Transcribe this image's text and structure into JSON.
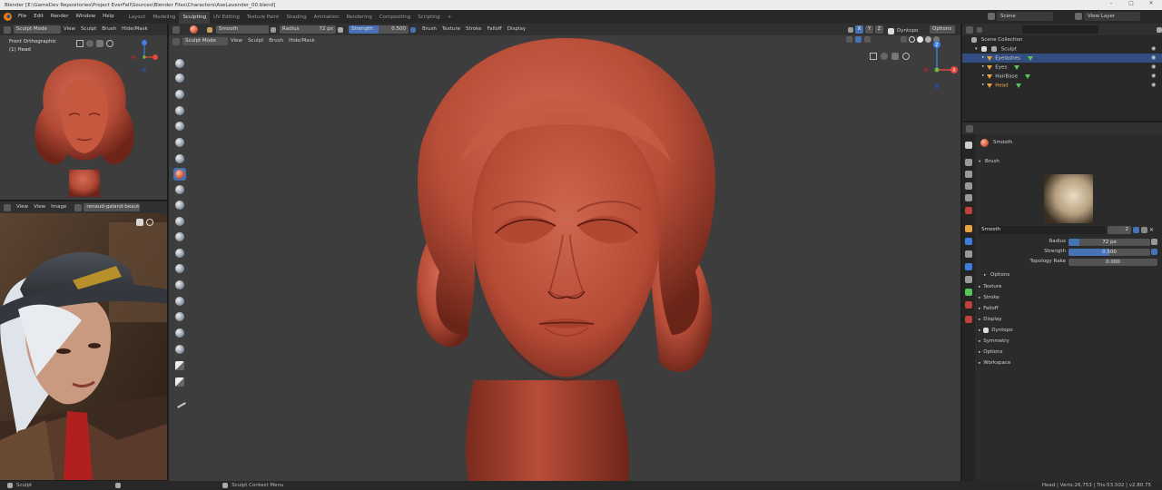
{
  "window": {
    "title": "Blender [E:\\GameDev Repositories\\Project EverFall\\Sources\\Blender Files\\Characters\\AxeLavender_00.blend]",
    "minimize_glyph": "–",
    "maximize_glyph": "□",
    "close_glyph": "✕"
  },
  "menu": {
    "items": [
      "File",
      "Edit",
      "Render",
      "Window",
      "Help"
    ]
  },
  "workspaces": {
    "tabs": [
      "Layout",
      "Modeling",
      "Sculpting",
      "UV Editing",
      "Texture Paint",
      "Shading",
      "Animation",
      "Rendering",
      "Compositing",
      "Scripting"
    ],
    "active": "Sculpting",
    "add": "+"
  },
  "scene": {
    "label": "Scene",
    "view_layer": "View Layer"
  },
  "left_viewport": {
    "mode": "Sculpt Mode",
    "menus": [
      "View",
      "Sculpt",
      "Brush",
      "Hide/Mask"
    ],
    "view_name": "Front Orthographic",
    "object": "(1) Head"
  },
  "image_editor": {
    "menus": [
      "View",
      "View",
      "Image"
    ],
    "image_name": "renaud-galand-beaut..."
  },
  "tool_header": {
    "brush_name": "Smooth",
    "radius_label": "Radius",
    "radius_value": "72 px",
    "strength_label": "Strength",
    "strength_value": "0.500",
    "menus": [
      "Brush",
      "Texture",
      "Stroke",
      "Falloff",
      "Display"
    ]
  },
  "main_viewport": {
    "mode": "Sculpt Mode",
    "menus": [
      "View",
      "Sculpt",
      "Brush",
      "Hide/Mask"
    ],
    "axes": [
      "X",
      "Y",
      "Z"
    ],
    "dyntopo": "Dyntopo",
    "options": "Options"
  },
  "gizmo_labels": {
    "x": "X",
    "y": "Y",
    "z": "Z"
  },
  "outliner": {
    "search_placeholder": "",
    "root": "Scene Collection",
    "collection": "Sculpt",
    "items": [
      {
        "name": "Eyelashes",
        "selected": true
      },
      {
        "name": "Eyes",
        "selected": false
      },
      {
        "name": "HairBase",
        "selected": false
      },
      {
        "name": "Head",
        "selected": false
      }
    ]
  },
  "properties": {
    "brush_name": "Smooth",
    "section_brush": "Brush",
    "brush_datablock": "Smooth",
    "user_count": "2",
    "radius_label": "Radius",
    "radius_value": "72 px",
    "radius_fraction": 0.13,
    "strength_label": "Strength",
    "strength_value": "0.500",
    "strength_fraction": 0.5,
    "topology_rake_label": "Topology Rake",
    "topology_rake_value": "0.000",
    "options_sub": "Options",
    "sections": [
      "Texture",
      "Stroke",
      "Falloff",
      "Display",
      "Dyntopo",
      "Symmetry",
      "Options",
      "Workspace"
    ]
  },
  "status": {
    "left": "Sculpt",
    "middle": "Sculpt Context Menu",
    "right": "Head | Verts:26,753 | Tris:53,502 | v2.80.75"
  },
  "colors": {
    "accent": "#4772b3",
    "clay": "#c0523e",
    "selection": "#334d80",
    "axis_x": "#e8453c",
    "axis_y": "#72b547",
    "axis_z": "#3f7ee0"
  }
}
